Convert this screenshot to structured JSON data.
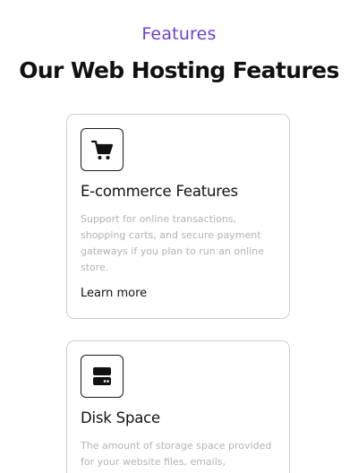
{
  "section": {
    "eyebrow": "Features",
    "heading": "Our Web Hosting Features"
  },
  "cards": [
    {
      "icon": "shopping-cart-icon",
      "title": "E-commerce Features",
      "description": "Support for online transactions, shopping carts, and secure payment gateways if you plan to run an online store.",
      "link": "Learn more"
    },
    {
      "icon": "storage-drive-icon",
      "title": "Disk Space",
      "description": "The amount of storage space provided for your website files, emails, databases, etc."
    }
  ],
  "colors": {
    "accent": "#6c3fcf",
    "heading": "#111111",
    "muted_text": "#b3b3b3",
    "card_border": "#cfcfcf"
  }
}
